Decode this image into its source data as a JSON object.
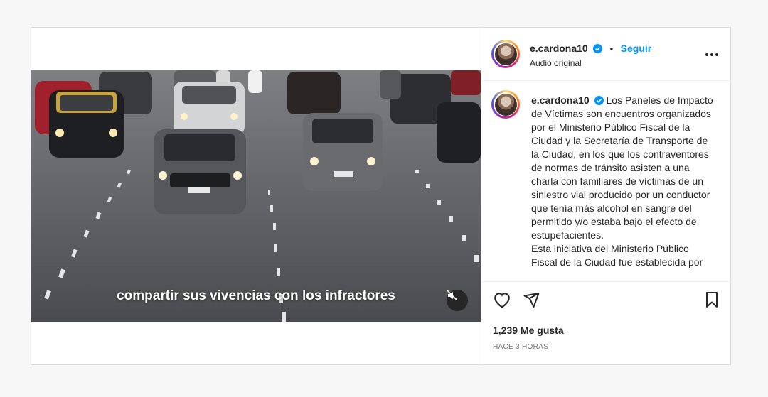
{
  "post": {
    "username": "e.cardona10",
    "follow_label": "Seguir",
    "separator": "•",
    "audio": "Audio original",
    "subtitle": "compartir sus vivencias con los infractores",
    "caption": "Los Paneles de Impacto de Víctimas son encuentros organizados por el Ministerio Público Fiscal de la Ciudad y la Secretaría de Transporte de la Ciudad, en los que los contraventores de normas de tránsito asisten a una charla con familiares de víctimas de un siniestro vial producido por un conductor que tenía más alcohol en sangre del permitido y/o estaba bajo el efecto de estupefacientes.",
    "caption_2": "Esta iniciativa del Ministerio Público Fiscal de la Ciudad fue establecida por",
    "likes": "1,239 Me gusta",
    "time": "HACE 3 HORAS"
  },
  "icons": {
    "verified": "verified-badge-icon",
    "more": "more-options-icon",
    "like": "heart-icon",
    "share": "share-icon",
    "save": "bookmark-icon",
    "mute": "muted-speaker-icon"
  },
  "colors": {
    "accent": "#0095f6",
    "border": "#dbdbdb",
    "background": "#f7f7f7",
    "muted_text": "#737373"
  }
}
